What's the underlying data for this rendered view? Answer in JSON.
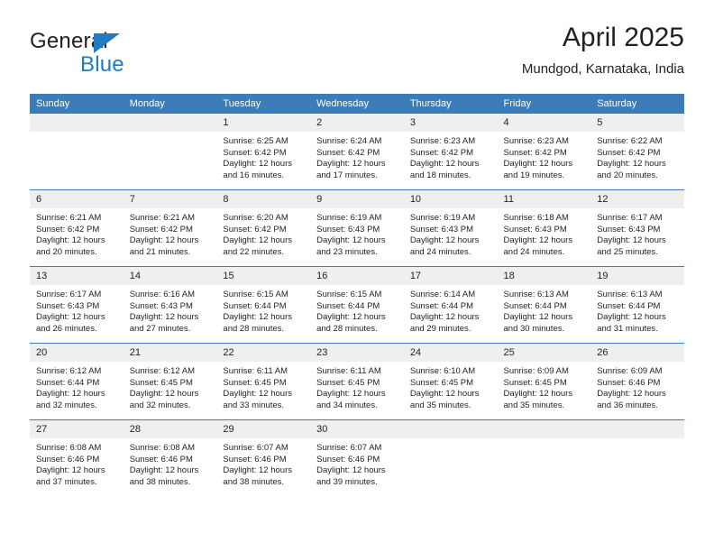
{
  "brand": {
    "name_part1": "General",
    "name_part2": "Blue",
    "triangle_color": "#1e7bc4"
  },
  "header": {
    "title": "April 2025",
    "subtitle": "Mundgod, Karnataka, India"
  },
  "theme": {
    "header_blue": "#3b7cb9",
    "daynum_gray": "#efefef",
    "text": "#231f20"
  },
  "weekday_headers": [
    "Sunday",
    "Monday",
    "Tuesday",
    "Wednesday",
    "Thursday",
    "Friday",
    "Saturday"
  ],
  "labels": {
    "sunrise_prefix": "Sunrise:",
    "sunset_prefix": "Sunset:",
    "daylight_prefix": "Daylight:"
  },
  "weeks": [
    [
      {
        "day": "",
        "empty": true,
        "sunrise": "",
        "sunset": "",
        "daylight_line1": "",
        "daylight_line2": ""
      },
      {
        "day": "",
        "empty": true,
        "sunrise": "",
        "sunset": "",
        "daylight_line1": "",
        "daylight_line2": ""
      },
      {
        "day": "1",
        "sunrise": "Sunrise: 6:25 AM",
        "sunset": "Sunset: 6:42 PM",
        "daylight_line1": "Daylight: 12 hours",
        "daylight_line2": "and 16 minutes."
      },
      {
        "day": "2",
        "sunrise": "Sunrise: 6:24 AM",
        "sunset": "Sunset: 6:42 PM",
        "daylight_line1": "Daylight: 12 hours",
        "daylight_line2": "and 17 minutes."
      },
      {
        "day": "3",
        "sunrise": "Sunrise: 6:23 AM",
        "sunset": "Sunset: 6:42 PM",
        "daylight_line1": "Daylight: 12 hours",
        "daylight_line2": "and 18 minutes."
      },
      {
        "day": "4",
        "sunrise": "Sunrise: 6:23 AM",
        "sunset": "Sunset: 6:42 PM",
        "daylight_line1": "Daylight: 12 hours",
        "daylight_line2": "and 19 minutes."
      },
      {
        "day": "5",
        "sunrise": "Sunrise: 6:22 AM",
        "sunset": "Sunset: 6:42 PM",
        "daylight_line1": "Daylight: 12 hours",
        "daylight_line2": "and 20 minutes."
      }
    ],
    [
      {
        "day": "6",
        "sunrise": "Sunrise: 6:21 AM",
        "sunset": "Sunset: 6:42 PM",
        "daylight_line1": "Daylight: 12 hours",
        "daylight_line2": "and 20 minutes."
      },
      {
        "day": "7",
        "sunrise": "Sunrise: 6:21 AM",
        "sunset": "Sunset: 6:42 PM",
        "daylight_line1": "Daylight: 12 hours",
        "daylight_line2": "and 21 minutes."
      },
      {
        "day": "8",
        "sunrise": "Sunrise: 6:20 AM",
        "sunset": "Sunset: 6:42 PM",
        "daylight_line1": "Daylight: 12 hours",
        "daylight_line2": "and 22 minutes."
      },
      {
        "day": "9",
        "sunrise": "Sunrise: 6:19 AM",
        "sunset": "Sunset: 6:43 PM",
        "daylight_line1": "Daylight: 12 hours",
        "daylight_line2": "and 23 minutes."
      },
      {
        "day": "10",
        "sunrise": "Sunrise: 6:19 AM",
        "sunset": "Sunset: 6:43 PM",
        "daylight_line1": "Daylight: 12 hours",
        "daylight_line2": "and 24 minutes."
      },
      {
        "day": "11",
        "sunrise": "Sunrise: 6:18 AM",
        "sunset": "Sunset: 6:43 PM",
        "daylight_line1": "Daylight: 12 hours",
        "daylight_line2": "and 24 minutes."
      },
      {
        "day": "12",
        "sunrise": "Sunrise: 6:17 AM",
        "sunset": "Sunset: 6:43 PM",
        "daylight_line1": "Daylight: 12 hours",
        "daylight_line2": "and 25 minutes."
      }
    ],
    [
      {
        "day": "13",
        "sunrise": "Sunrise: 6:17 AM",
        "sunset": "Sunset: 6:43 PM",
        "daylight_line1": "Daylight: 12 hours",
        "daylight_line2": "and 26 minutes."
      },
      {
        "day": "14",
        "sunrise": "Sunrise: 6:16 AM",
        "sunset": "Sunset: 6:43 PM",
        "daylight_line1": "Daylight: 12 hours",
        "daylight_line2": "and 27 minutes."
      },
      {
        "day": "15",
        "sunrise": "Sunrise: 6:15 AM",
        "sunset": "Sunset: 6:44 PM",
        "daylight_line1": "Daylight: 12 hours",
        "daylight_line2": "and 28 minutes."
      },
      {
        "day": "16",
        "sunrise": "Sunrise: 6:15 AM",
        "sunset": "Sunset: 6:44 PM",
        "daylight_line1": "Daylight: 12 hours",
        "daylight_line2": "and 28 minutes."
      },
      {
        "day": "17",
        "sunrise": "Sunrise: 6:14 AM",
        "sunset": "Sunset: 6:44 PM",
        "daylight_line1": "Daylight: 12 hours",
        "daylight_line2": "and 29 minutes."
      },
      {
        "day": "18",
        "sunrise": "Sunrise: 6:13 AM",
        "sunset": "Sunset: 6:44 PM",
        "daylight_line1": "Daylight: 12 hours",
        "daylight_line2": "and 30 minutes."
      },
      {
        "day": "19",
        "sunrise": "Sunrise: 6:13 AM",
        "sunset": "Sunset: 6:44 PM",
        "daylight_line1": "Daylight: 12 hours",
        "daylight_line2": "and 31 minutes."
      }
    ],
    [
      {
        "day": "20",
        "sunrise": "Sunrise: 6:12 AM",
        "sunset": "Sunset: 6:44 PM",
        "daylight_line1": "Daylight: 12 hours",
        "daylight_line2": "and 32 minutes."
      },
      {
        "day": "21",
        "sunrise": "Sunrise: 6:12 AM",
        "sunset": "Sunset: 6:45 PM",
        "daylight_line1": "Daylight: 12 hours",
        "daylight_line2": "and 32 minutes."
      },
      {
        "day": "22",
        "sunrise": "Sunrise: 6:11 AM",
        "sunset": "Sunset: 6:45 PM",
        "daylight_line1": "Daylight: 12 hours",
        "daylight_line2": "and 33 minutes."
      },
      {
        "day": "23",
        "sunrise": "Sunrise: 6:11 AM",
        "sunset": "Sunset: 6:45 PM",
        "daylight_line1": "Daylight: 12 hours",
        "daylight_line2": "and 34 minutes."
      },
      {
        "day": "24",
        "sunrise": "Sunrise: 6:10 AM",
        "sunset": "Sunset: 6:45 PM",
        "daylight_line1": "Daylight: 12 hours",
        "daylight_line2": "and 35 minutes."
      },
      {
        "day": "25",
        "sunrise": "Sunrise: 6:09 AM",
        "sunset": "Sunset: 6:45 PM",
        "daylight_line1": "Daylight: 12 hours",
        "daylight_line2": "and 35 minutes."
      },
      {
        "day": "26",
        "sunrise": "Sunrise: 6:09 AM",
        "sunset": "Sunset: 6:46 PM",
        "daylight_line1": "Daylight: 12 hours",
        "daylight_line2": "and 36 minutes."
      }
    ],
    [
      {
        "day": "27",
        "sunrise": "Sunrise: 6:08 AM",
        "sunset": "Sunset: 6:46 PM",
        "daylight_line1": "Daylight: 12 hours",
        "daylight_line2": "and 37 minutes."
      },
      {
        "day": "28",
        "sunrise": "Sunrise: 6:08 AM",
        "sunset": "Sunset: 6:46 PM",
        "daylight_line1": "Daylight: 12 hours",
        "daylight_line2": "and 38 minutes."
      },
      {
        "day": "29",
        "sunrise": "Sunrise: 6:07 AM",
        "sunset": "Sunset: 6:46 PM",
        "daylight_line1": "Daylight: 12 hours",
        "daylight_line2": "and 38 minutes."
      },
      {
        "day": "30",
        "sunrise": "Sunrise: 6:07 AM",
        "sunset": "Sunset: 6:46 PM",
        "daylight_line1": "Daylight: 12 hours",
        "daylight_line2": "and 39 minutes."
      },
      {
        "day": "",
        "blank": true,
        "sunrise": "",
        "sunset": "",
        "daylight_line1": "",
        "daylight_line2": ""
      },
      {
        "day": "",
        "blank": true,
        "sunrise": "",
        "sunset": "",
        "daylight_line1": "",
        "daylight_line2": ""
      },
      {
        "day": "",
        "blank": true,
        "sunrise": "",
        "sunset": "",
        "daylight_line1": "",
        "daylight_line2": ""
      }
    ]
  ]
}
